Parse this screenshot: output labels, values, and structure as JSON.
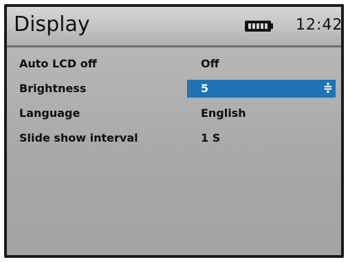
{
  "header": {
    "title": "Display",
    "battery_icon": "battery-full-icon",
    "time": "12:42"
  },
  "settings": [
    {
      "label": "Auto LCD off",
      "value": "Off",
      "selected": false
    },
    {
      "label": "Brightness",
      "value": "5",
      "selected": true
    },
    {
      "label": "Language",
      "value": "English",
      "selected": false
    },
    {
      "label": "Slide show interval",
      "value": "1 S",
      "selected": false
    }
  ],
  "colors": {
    "highlight": "#1f73b6",
    "text": "#0e0e0e",
    "background": "#a8a8a8"
  },
  "spinner_glyph": "≑"
}
